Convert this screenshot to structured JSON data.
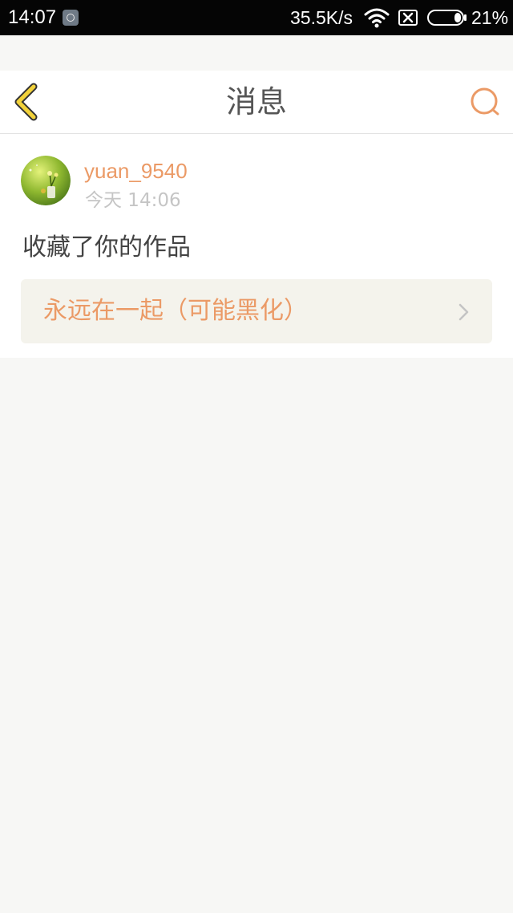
{
  "status_bar": {
    "time": "14:07",
    "network_speed": "35.5K/s",
    "battery_percent": "21%",
    "battery_level": 0.21,
    "icons": [
      "app-notification-icon",
      "wifi-icon",
      "no-sim-icon",
      "battery-icon"
    ]
  },
  "header": {
    "title": "消息",
    "back_icon": "chevron-left-icon",
    "search_icon": "search-icon"
  },
  "message": {
    "username": "yuan_9540",
    "timestamp": "今天 14:06",
    "action_text": "收藏了你的作品",
    "work_title": "永远在一起（可能黑化）",
    "link_icon": "chevron-right-icon"
  },
  "colors": {
    "accent": "#eb9a66",
    "back_arrow": "#f2d23a",
    "page_background": "#f7f7f5",
    "card_link_background": "#f4f3ec"
  }
}
